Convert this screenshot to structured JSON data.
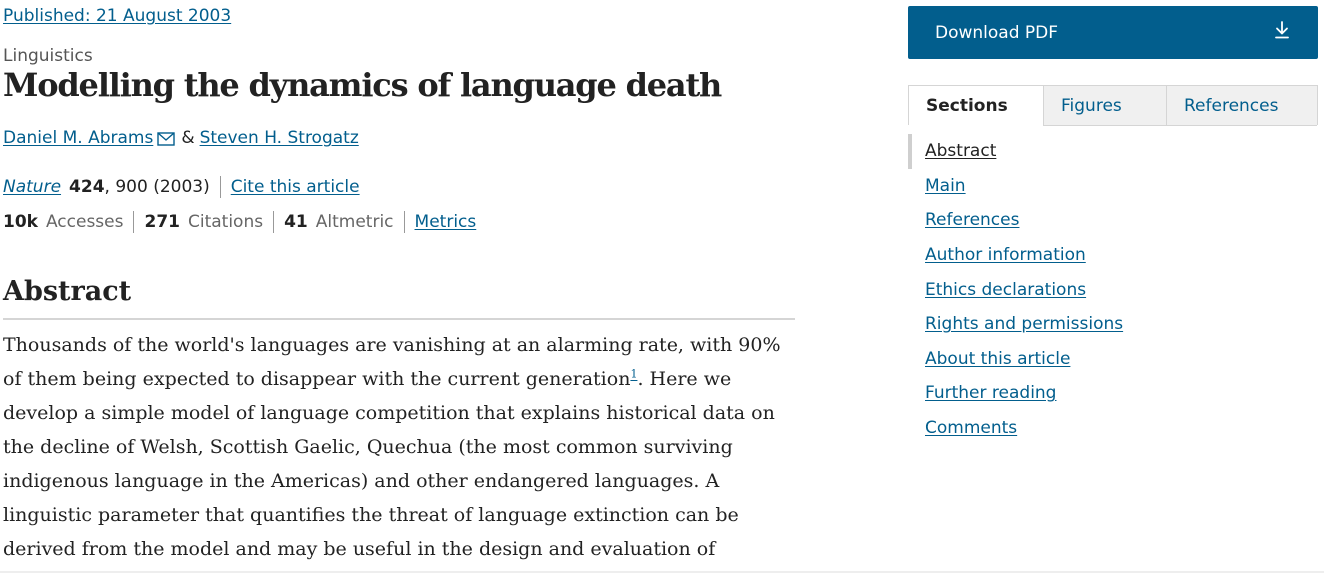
{
  "article": {
    "published_prefix": "Published: ",
    "published_date": "21 August 2003",
    "subject": "Linguistics",
    "title": "Modelling the dynamics of language death",
    "authors": [
      {
        "name": "Daniel M. Abrams"
      },
      {
        "name": "Steven H. Strogatz"
      }
    ],
    "author_separator": "&",
    "citation": {
      "journal": "Nature",
      "volume": "424",
      "rest": ", 900 (2003)",
      "cite_link": "Cite this article"
    },
    "metrics": {
      "accesses_value": "10k",
      "accesses_label": "Accesses",
      "citations_value": "271",
      "citations_label": "Citations",
      "altmetric_value": "41",
      "altmetric_label": "Altmetric",
      "metrics_link": "Metrics"
    },
    "abstract": {
      "heading": "Abstract",
      "text_before_ref": "Thousands of the world's languages are vanishing at an alarming rate, with 90% of them being expected to disappear with the current generation",
      "ref": "1",
      "text_after_ref": ". Here we develop a simple model of language competition that explains historical data on the decline of Welsh, Scottish Gaelic, Quechua (the most common surviving indigenous language in the Americas) and other endangered languages. A linguistic parameter that quantifies the threat of language extinction can be derived from the model and may be useful in the design and evaluation of language-preservation programmes."
    }
  },
  "sidebar": {
    "download_label": "Download PDF",
    "download_icon": "download-icon",
    "tabs": [
      {
        "label": "Sections",
        "active": true
      },
      {
        "label": "Figures",
        "active": false
      },
      {
        "label": "References",
        "active": false
      }
    ],
    "toc": [
      {
        "label": "Abstract",
        "active": true
      },
      {
        "label": "Main"
      },
      {
        "label": "References"
      },
      {
        "label": "Author information"
      },
      {
        "label": "Ethics declarations"
      },
      {
        "label": "Rights and permissions"
      },
      {
        "label": "About this article"
      },
      {
        "label": "Further reading"
      },
      {
        "label": "Comments"
      }
    ]
  },
  "colors": {
    "link": "#025e8d",
    "button_bg": "#025e8d",
    "text": "#222222"
  }
}
